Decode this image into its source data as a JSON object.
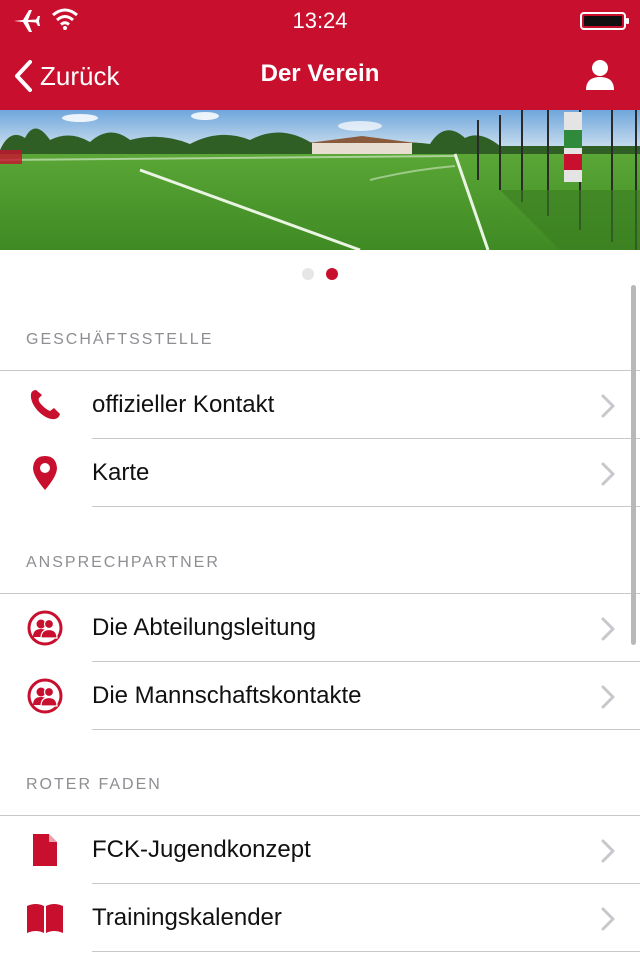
{
  "status_bar": {
    "time": "13:24"
  },
  "nav": {
    "back_label": "Zurück",
    "title": "Der Verein"
  },
  "carousel": {
    "page_count": 2,
    "active_index": 1
  },
  "sections": [
    {
      "header": "GESCHÄFTSSTELLE",
      "items": [
        {
          "label": "offizieller Kontakt",
          "icon": "phone-icon"
        },
        {
          "label": "Karte",
          "icon": "map-pin-icon"
        }
      ]
    },
    {
      "header": "ANSPRECHPARTNER",
      "items": [
        {
          "label": "Die Abteilungsleitung",
          "icon": "people-icon"
        },
        {
          "label": "Die Mannschaftskontakte",
          "icon": "people-icon"
        }
      ]
    },
    {
      "header": "ROTER FADEN",
      "items": [
        {
          "label": "FCK-Jugendkonzept",
          "icon": "document-icon"
        },
        {
          "label": "Trainingskalender",
          "icon": "book-icon"
        }
      ]
    }
  ],
  "colors": {
    "brand": "#c8102e",
    "section_text": "#8e8e93",
    "separator": "#c8c7cc"
  }
}
